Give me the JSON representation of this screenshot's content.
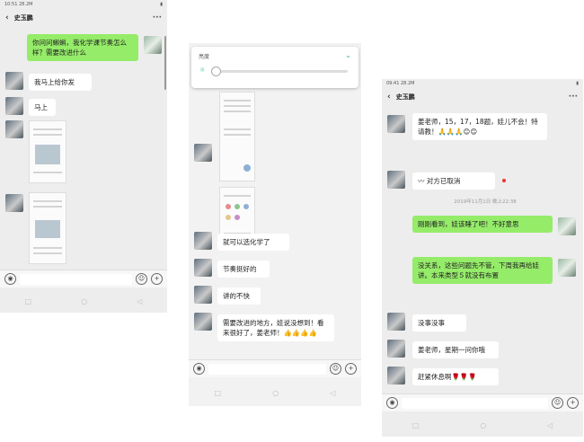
{
  "phone1": {
    "status_time": "10:51 28.2M",
    "contact": "史玉鹏",
    "more": "···",
    "messages": [
      "你问问蝌蝌，我化学课节奏怎么样？需要改进什么",
      "我马上给你发",
      "马上"
    ]
  },
  "phone2": {
    "brightness_label": "亮度",
    "messages": [
      "就可以选化学了",
      "节奏挺好的",
      "讲的不快",
      "需要改进的地方，娃说没想到！看来很好了，姜老师！👍👍👍👍"
    ]
  },
  "phone3": {
    "status_time": "09:41 28.2M",
    "contact": "史玉鹏",
    "more": "···",
    "messages": [
      "姜老师，15，17，18题，娃儿不会！特请教！🙏🙏🙏😊😊",
      "〰 对方已取消",
      "刚刚看到，娃该睡了吧！不好意思",
      "没关系，这些问题先不管，下周我再给娃讲。本来类型５就没有布置",
      "没事没事",
      "姜老师，星期一问你哦",
      "赶紧休息啊🌹🌹🌹"
    ],
    "timestamp": "2019年11月1日 晚上22:38"
  },
  "icons": {
    "voice": "voice-icon",
    "emoji": "emoji-icon",
    "plus": "plus-icon",
    "back": "back-icon"
  },
  "colors": {
    "sent_bubble": "#95ec69",
    "recv_bubble": "#ffffff",
    "chat_bg": "#ededed"
  }
}
